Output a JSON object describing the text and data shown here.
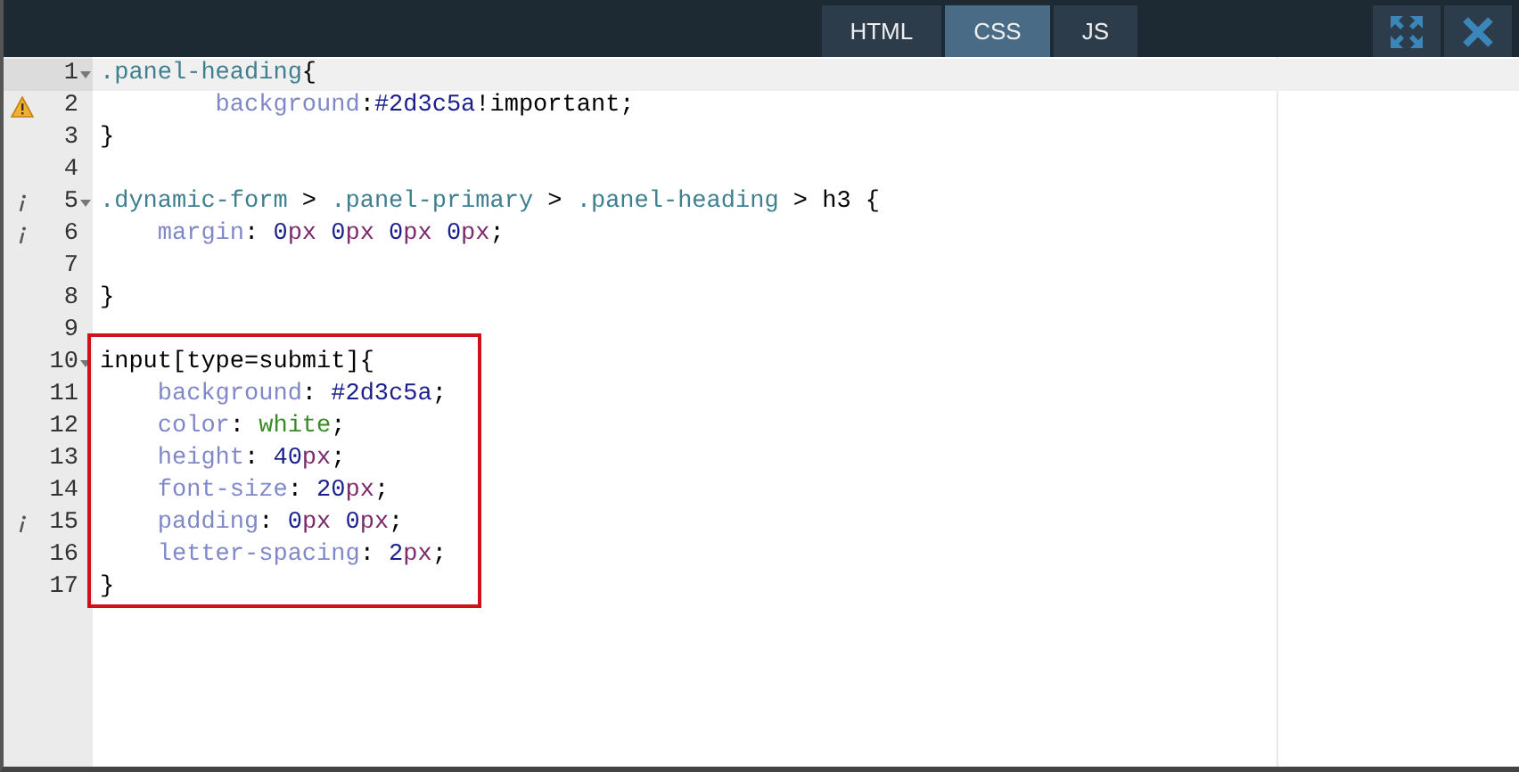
{
  "tabs": [
    {
      "label": "HTML",
      "selected": false
    },
    {
      "label": "CSS",
      "selected": true
    },
    {
      "label": "JS",
      "selected": false
    }
  ],
  "toolbar": [
    {
      "kind": "expand"
    },
    {
      "kind": "close"
    }
  ],
  "sections": [
    {
      "boxed": false,
      "lines": [
        {
          "number": "1",
          "fold": true,
          "kind": "plain",
          "active": true,
          "tokens": [
            {
              "kind": "selector",
              "text": ".panel-heading"
            },
            {
              "kind": "plain",
              "text": "{"
            }
          ]
        },
        {
          "number": "2",
          "fold": false,
          "kind": "warning",
          "active": false,
          "tokens": [
            {
              "kind": "property",
              "text": "        background"
            },
            {
              "kind": "plain",
              "text": ":"
            },
            {
              "kind": "value",
              "text": "#2d3c5a"
            },
            {
              "kind": "plain",
              "text": "!important;"
            }
          ]
        },
        {
          "number": "3",
          "fold": false,
          "kind": "plain",
          "active": false,
          "tokens": [
            {
              "kind": "plain",
              "text": "}"
            }
          ]
        },
        {
          "number": "4",
          "fold": false,
          "kind": "plain",
          "active": false
        },
        {
          "number": "5",
          "fold": true,
          "kind": "info",
          "active": false,
          "tokens": [
            {
              "kind": "selector",
              "text": ".dynamic-form"
            },
            {
              "kind": "plain",
              "text": " > "
            },
            {
              "kind": "selector",
              "text": ".panel-primary"
            },
            {
              "kind": "plain",
              "text": " > "
            },
            {
              "kind": "selector",
              "text": ".panel-heading"
            },
            {
              "kind": "plain",
              "text": " > h3 {"
            }
          ]
        },
        {
          "number": "6",
          "fold": false,
          "kind": "info",
          "active": false,
          "tokens": [
            {
              "kind": "property",
              "text": "    margin"
            },
            {
              "kind": "plain",
              "text": ": "
            },
            {
              "kind": "value",
              "text": "0"
            },
            {
              "kind": "unit",
              "text": "px"
            },
            {
              "kind": "value",
              "text": " 0"
            },
            {
              "kind": "unit",
              "text": "px"
            },
            {
              "kind": "value",
              "text": " 0"
            },
            {
              "kind": "unit",
              "text": "px"
            },
            {
              "kind": "value",
              "text": " 0"
            },
            {
              "kind": "unit",
              "text": "px"
            },
            {
              "kind": "plain",
              "text": ";"
            }
          ]
        },
        {
          "number": "7",
          "fold": false,
          "kind": "plain",
          "active": false
        },
        {
          "number": "8",
          "fold": false,
          "kind": "plain",
          "active": false,
          "tokens": [
            {
              "kind": "plain",
              "text": "}"
            }
          ]
        },
        {
          "number": "9",
          "fold": false,
          "kind": "plain",
          "active": false
        }
      ]
    },
    {
      "boxed": true,
      "lines": [
        {
          "number": "10",
          "fold": true,
          "kind": "plain",
          "active": false,
          "tokens": [
            {
              "kind": "plain",
              "text": "input[type=submit]{"
            }
          ]
        },
        {
          "number": "11",
          "fold": false,
          "kind": "plain",
          "active": false,
          "tokens": [
            {
              "kind": "property",
              "text": "    background"
            },
            {
              "kind": "plain",
              "text": ": "
            },
            {
              "kind": "value",
              "text": "#2d3c5a"
            },
            {
              "kind": "plain",
              "text": ";"
            }
          ]
        },
        {
          "number": "12",
          "fold": false,
          "kind": "plain",
          "active": false,
          "tokens": [
            {
              "kind": "property",
              "text": "    color"
            },
            {
              "kind": "plain",
              "text": ": "
            },
            {
              "kind": "keyword",
              "text": "white"
            },
            {
              "kind": "plain",
              "text": ";"
            }
          ]
        },
        {
          "number": "13",
          "fold": false,
          "kind": "plain",
          "active": false,
          "tokens": [
            {
              "kind": "property",
              "text": "    height"
            },
            {
              "kind": "plain",
              "text": ": "
            },
            {
              "kind": "value",
              "text": "40"
            },
            {
              "kind": "unit",
              "text": "px"
            },
            {
              "kind": "plain",
              "text": ";"
            }
          ]
        },
        {
          "number": "14",
          "fold": false,
          "kind": "plain",
          "active": false,
          "tokens": [
            {
              "kind": "property",
              "text": "    font-size"
            },
            {
              "kind": "plain",
              "text": ": "
            },
            {
              "kind": "value",
              "text": "20"
            },
            {
              "kind": "unit",
              "text": "px"
            },
            {
              "kind": "plain",
              "text": ";"
            }
          ]
        },
        {
          "number": "15",
          "fold": false,
          "kind": "info",
          "active": false,
          "tokens": [
            {
              "kind": "property",
              "text": "    padding"
            },
            {
              "kind": "plain",
              "text": ": "
            },
            {
              "kind": "value",
              "text": "0"
            },
            {
              "kind": "unit",
              "text": "px"
            },
            {
              "kind": "value",
              "text": " 0"
            },
            {
              "kind": "unit",
              "text": "px"
            },
            {
              "kind": "plain",
              "text": ";"
            }
          ]
        },
        {
          "number": "16",
          "fold": false,
          "kind": "plain",
          "active": false,
          "tokens": [
            {
              "kind": "property",
              "text": "    letter-spacing"
            },
            {
              "kind": "plain",
              "text": ": "
            },
            {
              "kind": "value",
              "text": "2"
            },
            {
              "kind": "unit",
              "text": "px"
            },
            {
              "kind": "plain",
              "text": ";"
            }
          ]
        },
        {
          "number": "17",
          "fold": false,
          "kind": "plain",
          "active": false,
          "tokens": [
            {
              "kind": "plain",
              "text": "}"
            }
          ]
        }
      ]
    }
  ]
}
